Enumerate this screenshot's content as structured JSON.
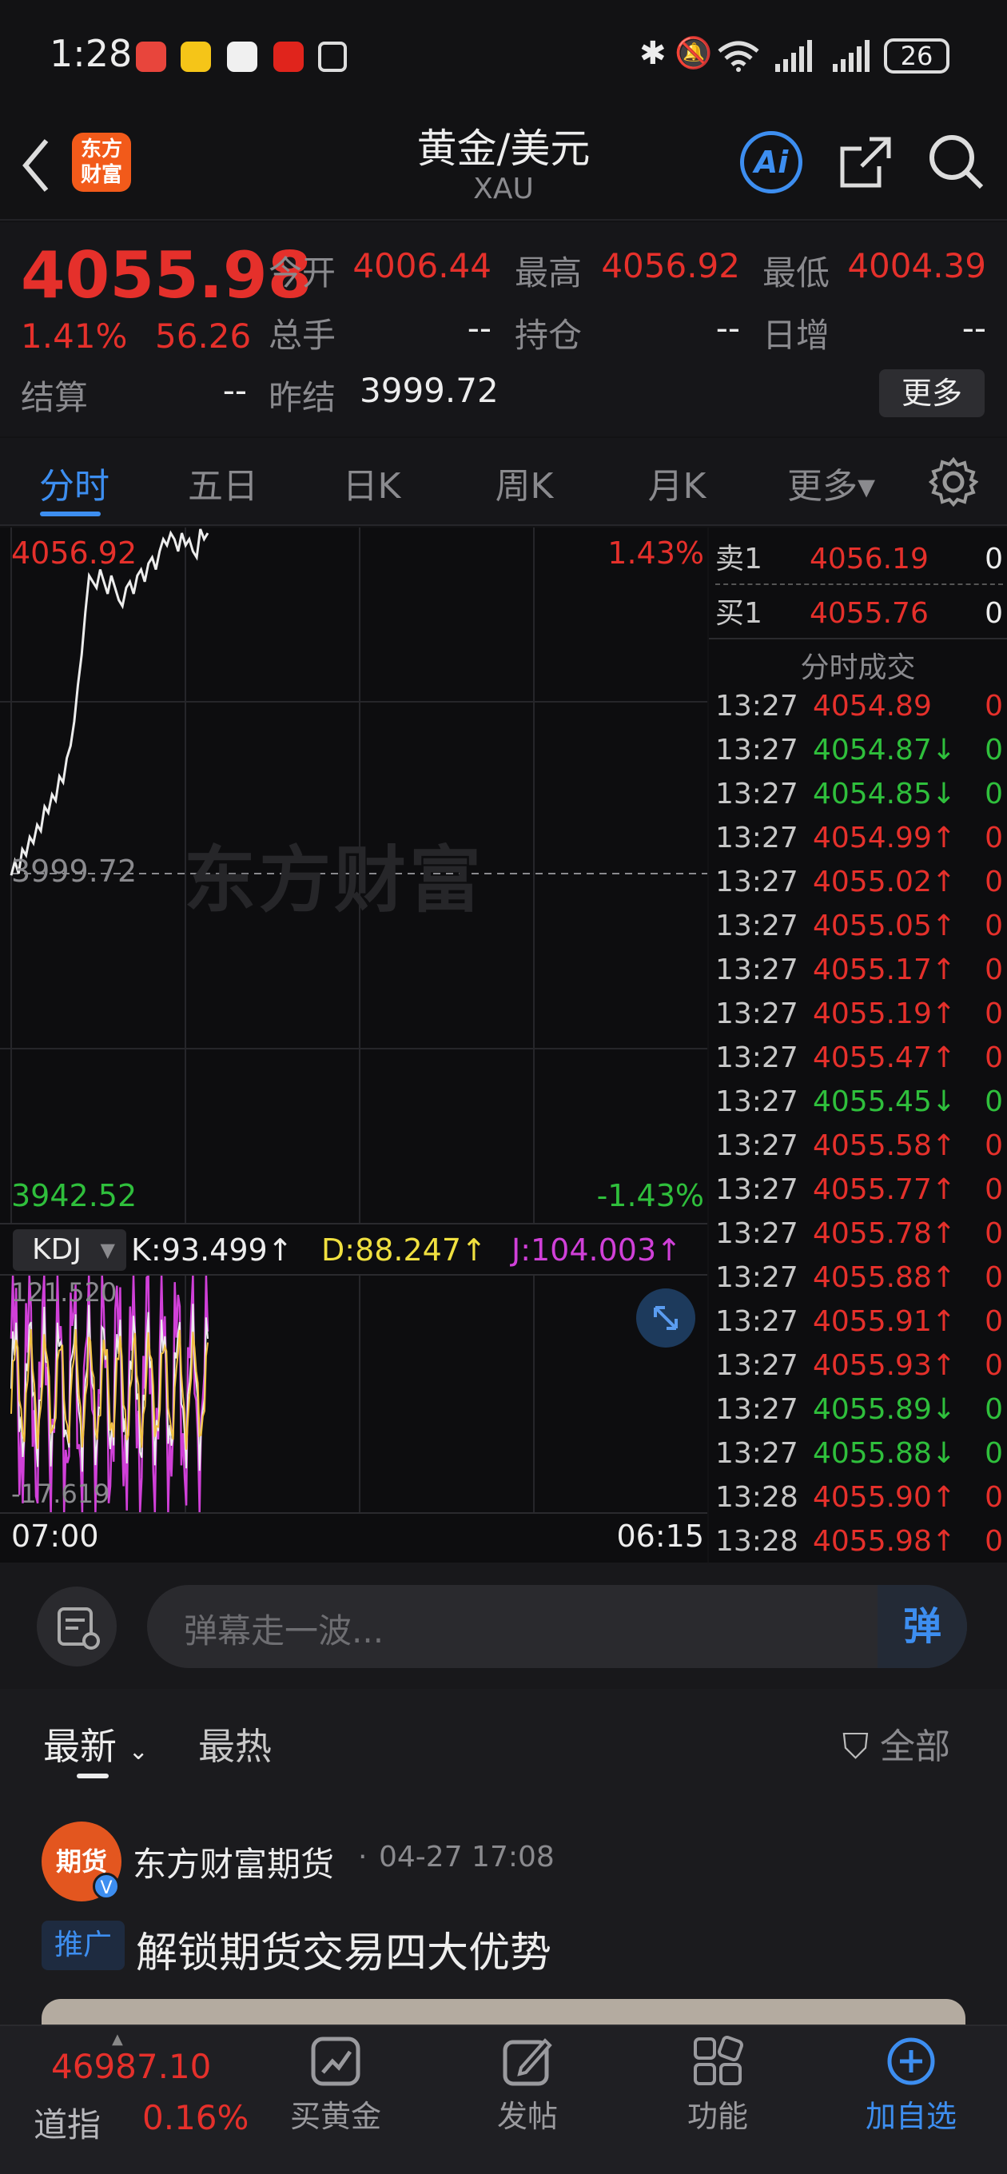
{
  "status_bar": {
    "time": "1:28",
    "battery": "26"
  },
  "header": {
    "title": "黄金/美元",
    "subtitle": "XAU",
    "ai_label": "Ai"
  },
  "quote": {
    "price": "4055.98",
    "change_pct": "1.41%",
    "change": "56.26",
    "open_label": "今开",
    "open": "4006.44",
    "high_label": "最高",
    "high": "4056.92",
    "low_label": "最低",
    "low": "4004.39",
    "volume_label": "总手",
    "volume": "--",
    "oi_label": "持仓",
    "oi": "--",
    "daily_inc_label": "日增",
    "daily_inc": "--",
    "settle_label": "结算",
    "settle": "--",
    "prev_settle_label": "昨结",
    "prev_settle": "3999.72",
    "more_label": "更多"
  },
  "tabs": [
    {
      "label": "分时",
      "active": true
    },
    {
      "label": "五日"
    },
    {
      "label": "日K"
    },
    {
      "label": "周K"
    },
    {
      "label": "月K"
    },
    {
      "label": "更多▾"
    }
  ],
  "chart": {
    "top_price": "4056.92",
    "top_pct": "1.43%",
    "mid_price": "3999.72",
    "watermark": "东方财富",
    "bottom_price": "3942.52",
    "bottom_pct": "-1.43%",
    "time_start": "07:00",
    "time_end": "06:15",
    "indicator": "KDJ",
    "k": "K:93.499↑",
    "d": "D:88.247↑",
    "j": "J:104.003↑",
    "ind_max": "121.520",
    "ind_min": "-17.619",
    "price_series": [
      3999.7,
      4002,
      4000,
      4004,
      4003,
      4006,
      4005,
      4008,
      4007,
      4011,
      4010,
      4013,
      4012,
      4016,
      4015,
      4019,
      4021,
      4025,
      4031,
      4036,
      4043,
      4049,
      4048,
      4047,
      4050,
      4048,
      4046,
      4049,
      4047,
      4045,
      4044,
      4047,
      4048,
      4046,
      4049,
      4050,
      4048,
      4051,
      4052,
      4050,
      4053,
      4055,
      4054,
      4056,
      4055,
      4053,
      4056,
      4054,
      4055,
      4053,
      4052,
      4056.9,
      4055,
      4056
    ]
  },
  "orderbook": {
    "sell_label": "卖1",
    "sell_price": "4056.19",
    "sell_vol": "0",
    "buy_label": "买1",
    "buy_price": "4055.76",
    "buy_vol": "0",
    "trades_title": "分时成交"
  },
  "trades": [
    {
      "time": "13:27",
      "price": "4054.89",
      "arrow": "",
      "vol": "0",
      "color": "red"
    },
    {
      "time": "13:27",
      "price": "4054.87",
      "arrow": "↓",
      "vol": "0",
      "color": "green"
    },
    {
      "time": "13:27",
      "price": "4054.85",
      "arrow": "↓",
      "vol": "0",
      "color": "green"
    },
    {
      "time": "13:27",
      "price": "4054.99",
      "arrow": "↑",
      "vol": "0",
      "color": "red"
    },
    {
      "time": "13:27",
      "price": "4055.02",
      "arrow": "↑",
      "vol": "0",
      "color": "red"
    },
    {
      "time": "13:27",
      "price": "4055.05",
      "arrow": "↑",
      "vol": "0",
      "color": "red"
    },
    {
      "time": "13:27",
      "price": "4055.17",
      "arrow": "↑",
      "vol": "0",
      "color": "red"
    },
    {
      "time": "13:27",
      "price": "4055.19",
      "arrow": "↑",
      "vol": "0",
      "color": "red"
    },
    {
      "time": "13:27",
      "price": "4055.47",
      "arrow": "↑",
      "vol": "0",
      "color": "red"
    },
    {
      "time": "13:27",
      "price": "4055.45",
      "arrow": "↓",
      "vol": "0",
      "color": "green"
    },
    {
      "time": "13:27",
      "price": "4055.58",
      "arrow": "↑",
      "vol": "0",
      "color": "red"
    },
    {
      "time": "13:27",
      "price": "4055.77",
      "arrow": "↑",
      "vol": "0",
      "color": "red"
    },
    {
      "time": "13:27",
      "price": "4055.78",
      "arrow": "↑",
      "vol": "0",
      "color": "red"
    },
    {
      "time": "13:27",
      "price": "4055.88",
      "arrow": "↑",
      "vol": "0",
      "color": "red"
    },
    {
      "time": "13:27",
      "price": "4055.91",
      "arrow": "↑",
      "vol": "0",
      "color": "red"
    },
    {
      "time": "13:27",
      "price": "4055.93",
      "arrow": "↑",
      "vol": "0",
      "color": "red"
    },
    {
      "time": "13:27",
      "price": "4055.89",
      "arrow": "↓",
      "vol": "0",
      "color": "green"
    },
    {
      "time": "13:27",
      "price": "4055.88",
      "arrow": "↓",
      "vol": "0",
      "color": "green"
    },
    {
      "time": "13:28",
      "price": "4055.90",
      "arrow": "↑",
      "vol": "0",
      "color": "red"
    },
    {
      "time": "13:28",
      "price": "4055.98",
      "arrow": "↑",
      "vol": "0",
      "color": "red"
    }
  ],
  "danmu": {
    "placeholder": "弹幕走一波...",
    "send_label": "弹"
  },
  "feed": {
    "tab_latest": "最新",
    "tab_hot": "最热",
    "filter_label": "全部",
    "post": {
      "author": "东方财富期货",
      "avatar_text": "期货",
      "separator": "·",
      "time": "04-27 17:08",
      "tag": "推广",
      "title": "解锁期货交易四大优势"
    }
  },
  "bottom_nav": {
    "index_value": "46987.10",
    "index_name": "道指",
    "index_pct": "0.16%",
    "items": [
      {
        "label": "买黄金",
        "icon": "chart-trend-icon"
      },
      {
        "label": "发帖",
        "icon": "edit-icon"
      },
      {
        "label": "功能",
        "icon": "grid-icon"
      },
      {
        "label": "加自选",
        "icon": "add-circle-icon"
      }
    ]
  },
  "colors": {
    "up": "#e5302b",
    "down": "#2fbf3c",
    "accent": "#3d8ef0",
    "brand": "#f25a1a"
  }
}
